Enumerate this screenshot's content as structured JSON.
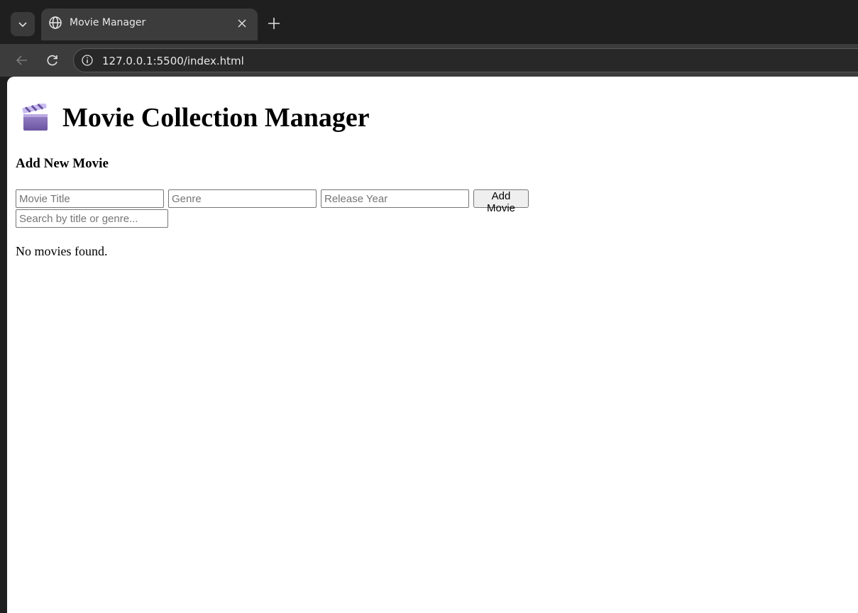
{
  "browser": {
    "tab": {
      "title": "Movie Manager"
    },
    "address_bar": {
      "url": "127.0.0.1:5500/index.html"
    }
  },
  "page": {
    "title": "Movie Collection Manager",
    "title_icon": "clapper-board-icon",
    "add_section": {
      "heading": "Add New Movie",
      "title_placeholder": "Movie Title",
      "genre_placeholder": "Genre",
      "year_placeholder": "Release Year",
      "add_button_label": "Add Movie"
    },
    "search": {
      "placeholder": "Search by title or genre..."
    },
    "empty_message": "No movies found."
  },
  "colors": {
    "chrome_dark": "#1f1f1f",
    "chrome_toolbar": "#3c3c3c",
    "page_background": "#ffffff"
  }
}
